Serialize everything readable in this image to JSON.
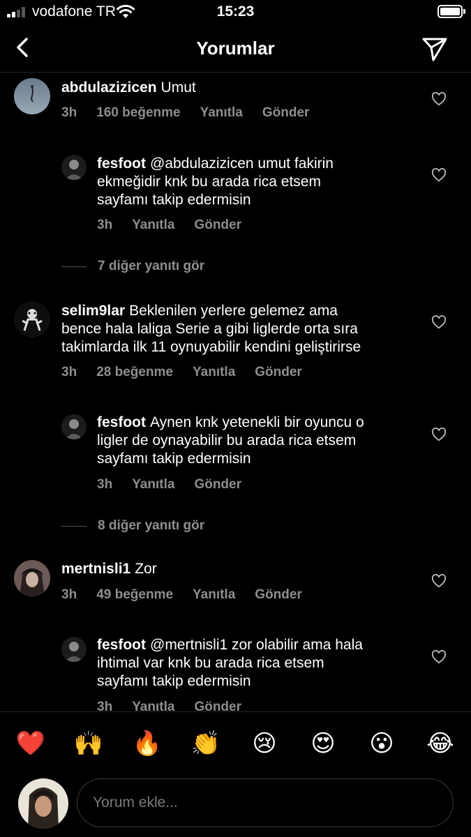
{
  "status_bar": {
    "carrier": "vodafone TR",
    "time": "15:23"
  },
  "header": {
    "title": "Yorumlar"
  },
  "comments": [
    {
      "username": "abdulazizicen",
      "text": "Umut",
      "time": "3h",
      "likes": "160 beğenme",
      "reply": "Yanıtla",
      "send": "Gönder",
      "replies": [
        {
          "username": "fesfoot",
          "lines": [
            "@abdulazizicen umut fakirin",
            "ekmeğidir knk bu arada rica etsem",
            "sayfamı takip edermisin"
          ],
          "time": "3h",
          "reply": "Yanıtla",
          "send": "Gönder"
        }
      ],
      "more_replies": "7 diğer yanıtı gör"
    },
    {
      "username": "selim9lar",
      "lines": [
        "Beklenilen yerlere gelemez ama",
        "bence hala laliga Serie a gibi liglerde orta sıra",
        "takimlarda ilk 11 oynuyabilir kendini geliştirirse"
      ],
      "time": "3h",
      "likes": "28 beğenme",
      "reply": "Yanıtla",
      "send": "Gönder",
      "replies": [
        {
          "username": "fesfoot",
          "lines": [
            "Aynen knk yetenekli bir oyuncu o",
            "ligler de oynayabilir bu arada rica etsem",
            "sayfamı takip edermisin"
          ],
          "time": "3h",
          "reply": "Yanıtla",
          "send": "Gönder"
        }
      ],
      "more_replies": "8 diğer yanıtı gör"
    },
    {
      "username": "mertnisli1",
      "text": "Zor",
      "time": "3h",
      "likes": "49 beğenme",
      "reply": "Yanıtla",
      "send": "Gönder",
      "replies": [
        {
          "username": "fesfoot",
          "lines": [
            "@mertnisli1 zor olabilir ama hala",
            "ihtimal var knk bu arada rica etsem",
            "sayfamı takip edermisin"
          ],
          "time": "3h",
          "reply": "Yanıtla",
          "send": "Gönder"
        }
      ]
    }
  ],
  "emoji_bar": [
    "❤️",
    "🙌",
    "🔥",
    "👏",
    "😢",
    "😍",
    "😮",
    "😂"
  ],
  "composer": {
    "placeholder": "Yorum ekle..."
  },
  "colors": {
    "background": "#000000",
    "secondary_text": "#8e8e8e",
    "divider": "#262626"
  },
  "icons": {
    "back": "chevron-left-icon",
    "send": "paper-plane-icon",
    "like": "heart-icon"
  }
}
